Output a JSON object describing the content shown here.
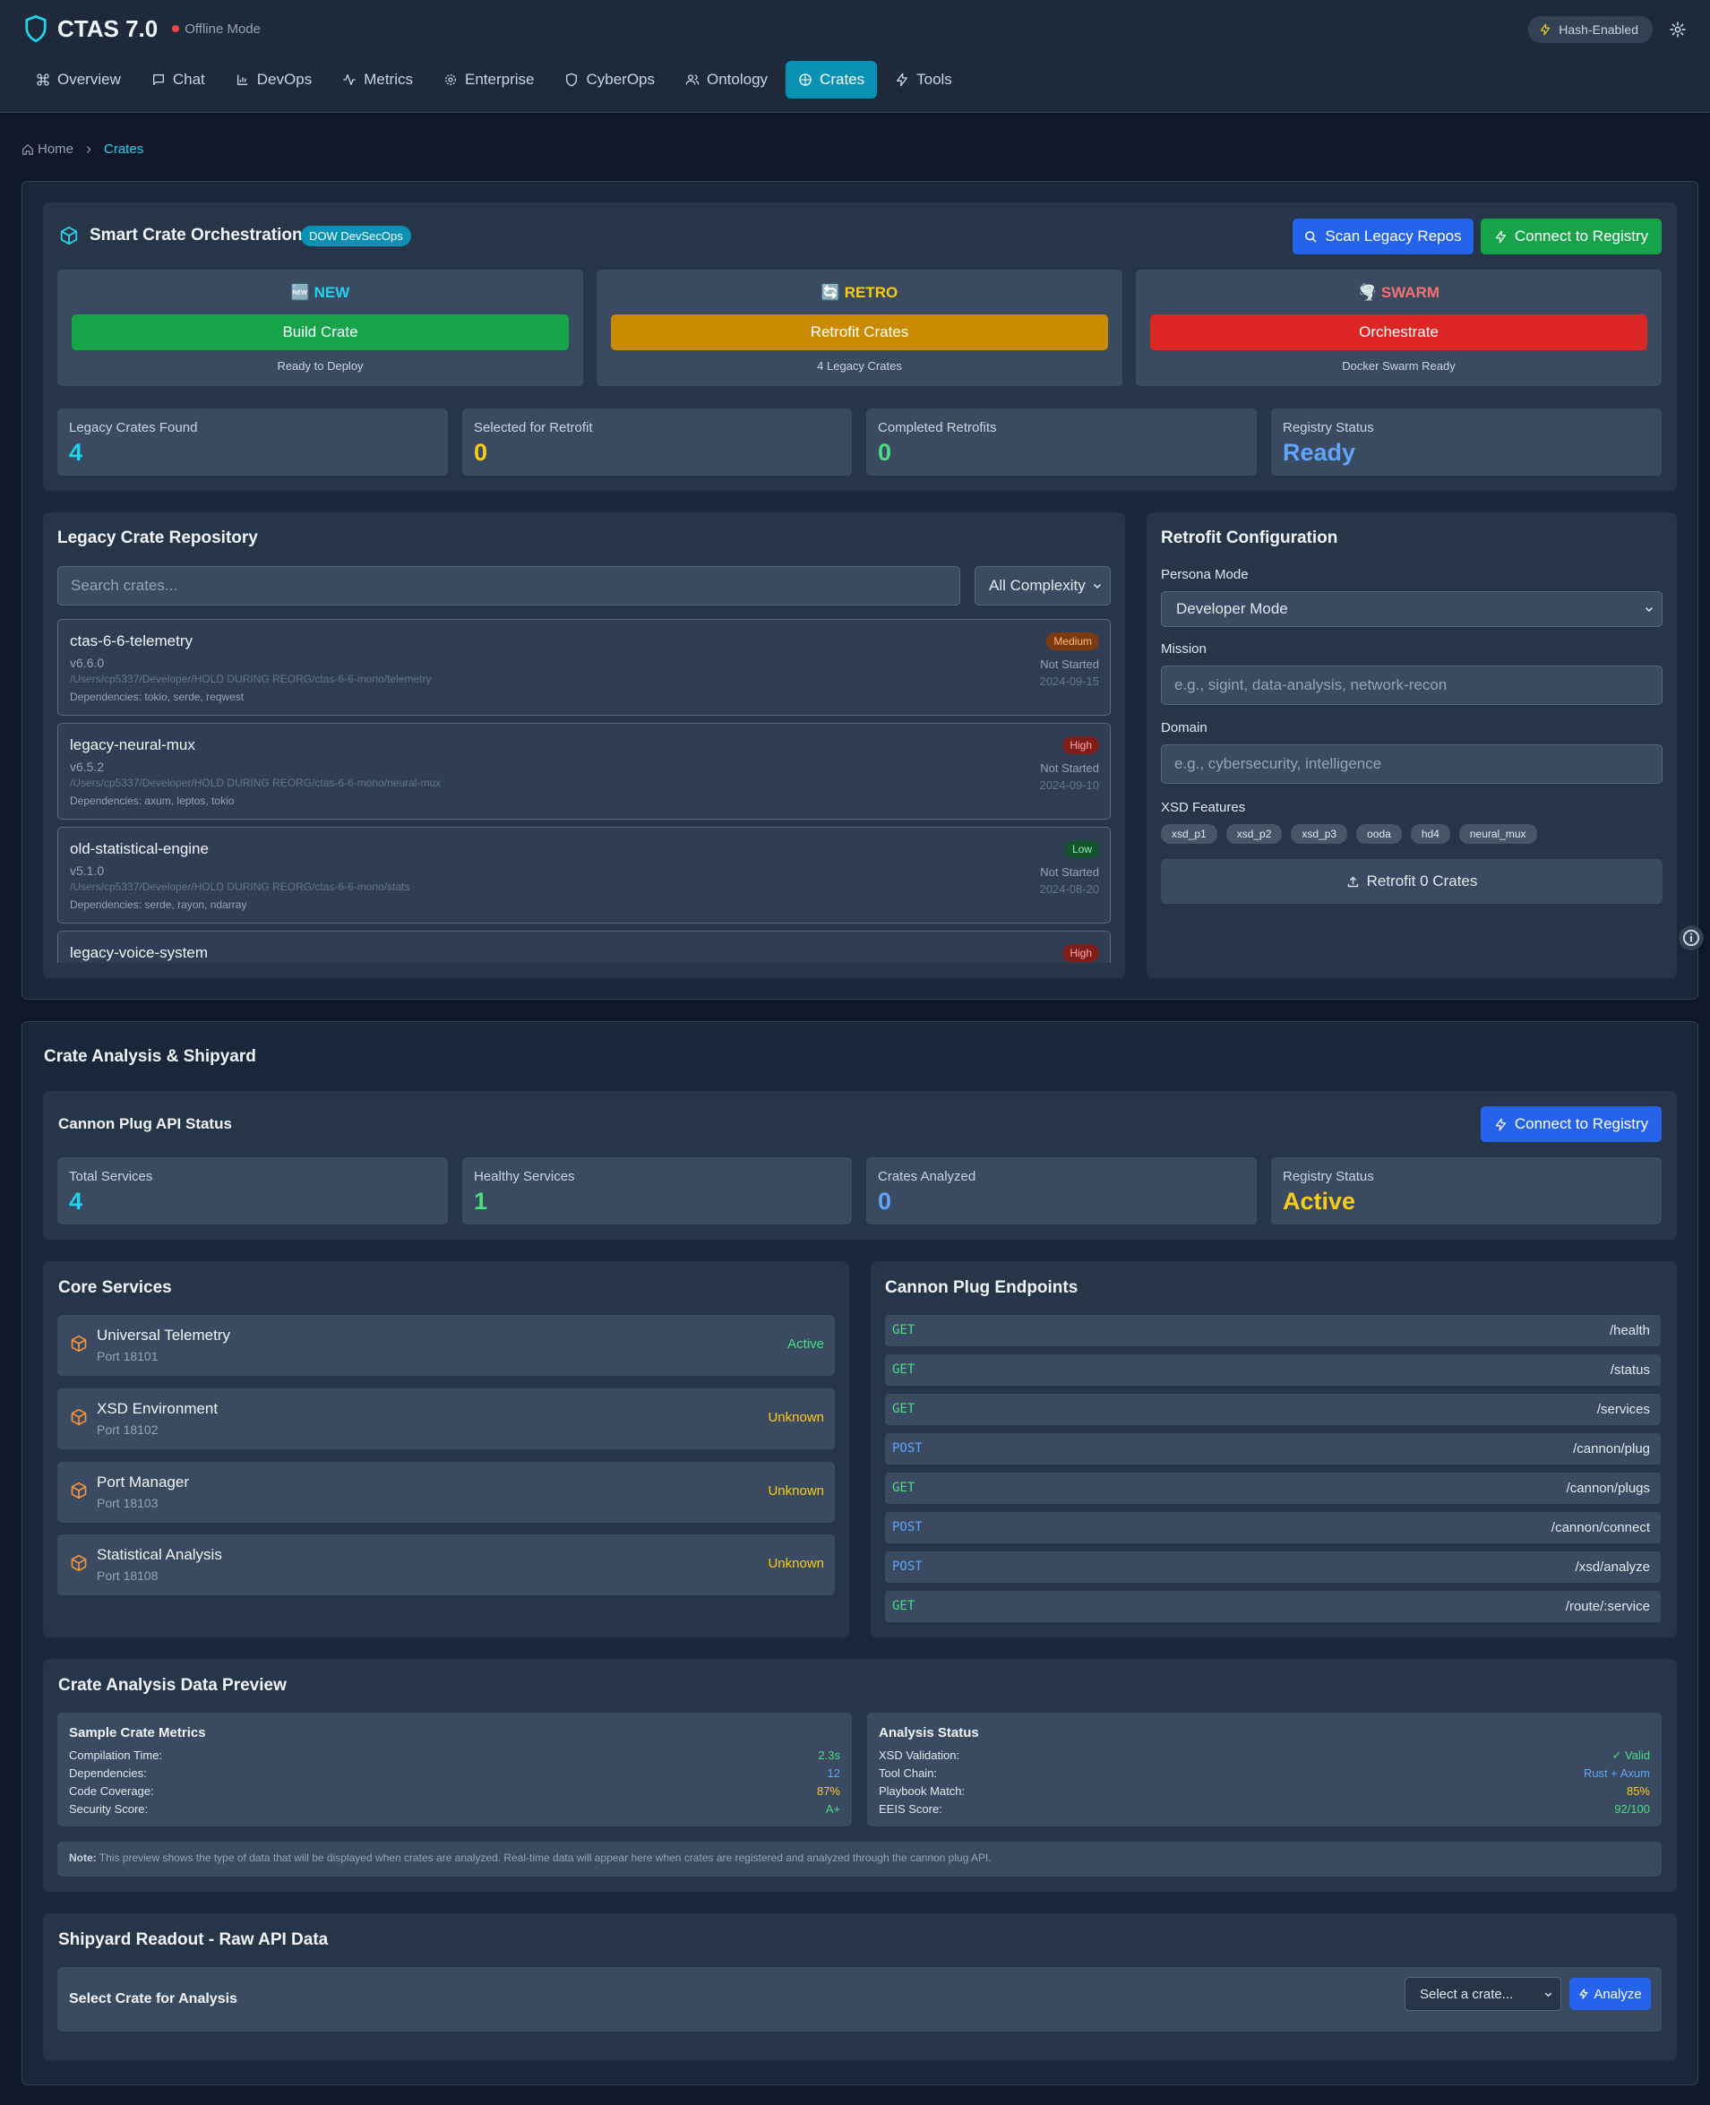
{
  "app": {
    "title": "CTAS 7.0",
    "mode": "Offline Mode",
    "hash_label": "Hash-Enabled"
  },
  "nav": [
    {
      "label": "Overview"
    },
    {
      "label": "Chat"
    },
    {
      "label": "DevOps"
    },
    {
      "label": "Metrics"
    },
    {
      "label": "Enterprise"
    },
    {
      "label": "CyberOps"
    },
    {
      "label": "Ontology"
    },
    {
      "label": "Crates"
    },
    {
      "label": "Tools"
    }
  ],
  "breadcrumb": {
    "home": "Home",
    "current": "Crates"
  },
  "orchestration": {
    "title": "Smart Crate Orchestration",
    "badge": "DOW DevSecOps",
    "scan_button": "Scan Legacy Repos",
    "connect_button": "Connect to Registry",
    "modes": [
      {
        "emoji": "🆕",
        "title": "NEW",
        "button": "Build Crate",
        "caption": "Ready to Deploy",
        "color": "#22d3ee"
      },
      {
        "emoji": "🔄",
        "title": "RETRO",
        "button": "Retrofit Crates",
        "caption": "4 Legacy Crates",
        "color": "#facc15"
      },
      {
        "emoji": "🌪️",
        "title": "SWARM",
        "button": "Orchestrate",
        "caption": "Docker Swarm Ready",
        "color": "#f87171"
      }
    ],
    "stats": [
      {
        "label": "Legacy Crates Found",
        "value": "4",
        "color": "#22d3ee"
      },
      {
        "label": "Selected for Retrofit",
        "value": "0",
        "color": "#facc15"
      },
      {
        "label": "Completed Retrofits",
        "value": "0",
        "color": "#4ade80"
      },
      {
        "label": "Registry Status",
        "value": "Ready",
        "color": "#60a5fa"
      }
    ]
  },
  "repository": {
    "title": "Legacy Crate Repository",
    "search_placeholder": "Search crates...",
    "filter_value": "All Complexity",
    "crates": [
      {
        "name": "ctas-6-6-telemetry",
        "version": "v6.6.0",
        "path": "/Users/cp5337/Developer/HOLD DURING REORG/ctas-6-6-mono/telemetry",
        "deps": "Dependencies: tokio, serde, reqwest",
        "complexity": "Medium",
        "status": "Not Started",
        "date": "2024-09-15"
      },
      {
        "name": "legacy-neural-mux",
        "version": "v6.5.2",
        "path": "/Users/cp5337/Developer/HOLD DURING REORG/ctas-6-6-mono/neural-mux",
        "deps": "Dependencies: axum, leptos, tokio",
        "complexity": "High",
        "status": "Not Started",
        "date": "2024-09-10"
      },
      {
        "name": "old-statistical-engine",
        "version": "v5.1.0",
        "path": "/Users/cp5337/Developer/HOLD DURING REORG/ctas-6-6-mono/stats",
        "deps": "Dependencies: serde, rayon, ndarray",
        "complexity": "Low",
        "status": "Not Started",
        "date": "2024-08-20"
      },
      {
        "name": "legacy-voice-system",
        "complexity": "High"
      }
    ]
  },
  "retrofit": {
    "title": "Retrofit Configuration",
    "persona_label": "Persona Mode",
    "persona_value": "Developer Mode",
    "mission_label": "Mission",
    "mission_placeholder": "e.g., sigint, data-analysis, network-recon",
    "domain_label": "Domain",
    "domain_placeholder": "e.g., cybersecurity, intelligence",
    "features_label": "XSD Features",
    "features": [
      "xsd_p1",
      "xsd_p2",
      "xsd_p3",
      "ooda",
      "hd4",
      "neural_mux"
    ],
    "button": "Retrofit 0 Crates"
  },
  "analysis": {
    "title": "Crate Analysis & Shipyard",
    "api_title": "Cannon Plug API Status",
    "connect_button": "Connect to Registry",
    "stats": [
      {
        "label": "Total Services",
        "value": "4",
        "color": "#22d3ee"
      },
      {
        "label": "Healthy Services",
        "value": "1",
        "color": "#4ade80"
      },
      {
        "label": "Crates Analyzed",
        "value": "0",
        "color": "#60a5fa"
      },
      {
        "label": "Registry Status",
        "value": "Active",
        "color": "#facc15"
      }
    ],
    "core_title": "Core Services",
    "services": [
      {
        "name": "Universal Telemetry",
        "port": "Port 18101",
        "status": "Active",
        "color": "#4ade80"
      },
      {
        "name": "XSD Environment",
        "port": "Port 18102",
        "status": "Unknown",
        "color": "#facc15"
      },
      {
        "name": "Port Manager",
        "port": "Port 18103",
        "status": "Unknown",
        "color": "#facc15"
      },
      {
        "name": "Statistical Analysis",
        "port": "Port 18108",
        "status": "Unknown",
        "color": "#facc15"
      }
    ],
    "endpoints_title": "Cannon Plug Endpoints",
    "endpoints": [
      {
        "method": "GET",
        "path": "/health"
      },
      {
        "method": "GET",
        "path": "/status"
      },
      {
        "method": "GET",
        "path": "/services"
      },
      {
        "method": "POST",
        "path": "/cannon/plug"
      },
      {
        "method": "GET",
        "path": "/cannon/plugs"
      },
      {
        "method": "POST",
        "path": "/cannon/connect"
      },
      {
        "method": "POST",
        "path": "/xsd/analyze"
      },
      {
        "method": "GET",
        "path": "/route/:service"
      }
    ]
  },
  "preview": {
    "title": "Crate Analysis Data Preview",
    "metrics_title": "Sample Crate Metrics",
    "metrics": [
      {
        "label": "Compilation Time:",
        "value": "2.3s",
        "color": "#4ade80"
      },
      {
        "label": "Dependencies:",
        "value": "12",
        "color": "#60a5fa"
      },
      {
        "label": "Code Coverage:",
        "value": "87%",
        "color": "#facc15"
      },
      {
        "label": "Security Score:",
        "value": "A+",
        "color": "#4ade80"
      }
    ],
    "status_title": "Analysis Status",
    "status": [
      {
        "label": "XSD Validation:",
        "value": "✓ Valid",
        "color": "#4ade80"
      },
      {
        "label": "Tool Chain:",
        "value": "Rust + Axum",
        "color": "#60a5fa"
      },
      {
        "label": "Playbook Match:",
        "value": "85%",
        "color": "#facc15"
      },
      {
        "label": "EEIS Score:",
        "value": "92/100",
        "color": "#4ade80"
      }
    ],
    "note_label": "Note:",
    "note_text": "This preview shows the type of data that will be displayed when crates are analyzed. Real-time data will appear here when crates are registered and analyzed through the cannon plug API."
  },
  "shipyard": {
    "title": "Shipyard Readout - Raw API Data",
    "select_title": "Select Crate for Analysis",
    "select_value": "Select a crate...",
    "analyze_button": "Analyze"
  }
}
